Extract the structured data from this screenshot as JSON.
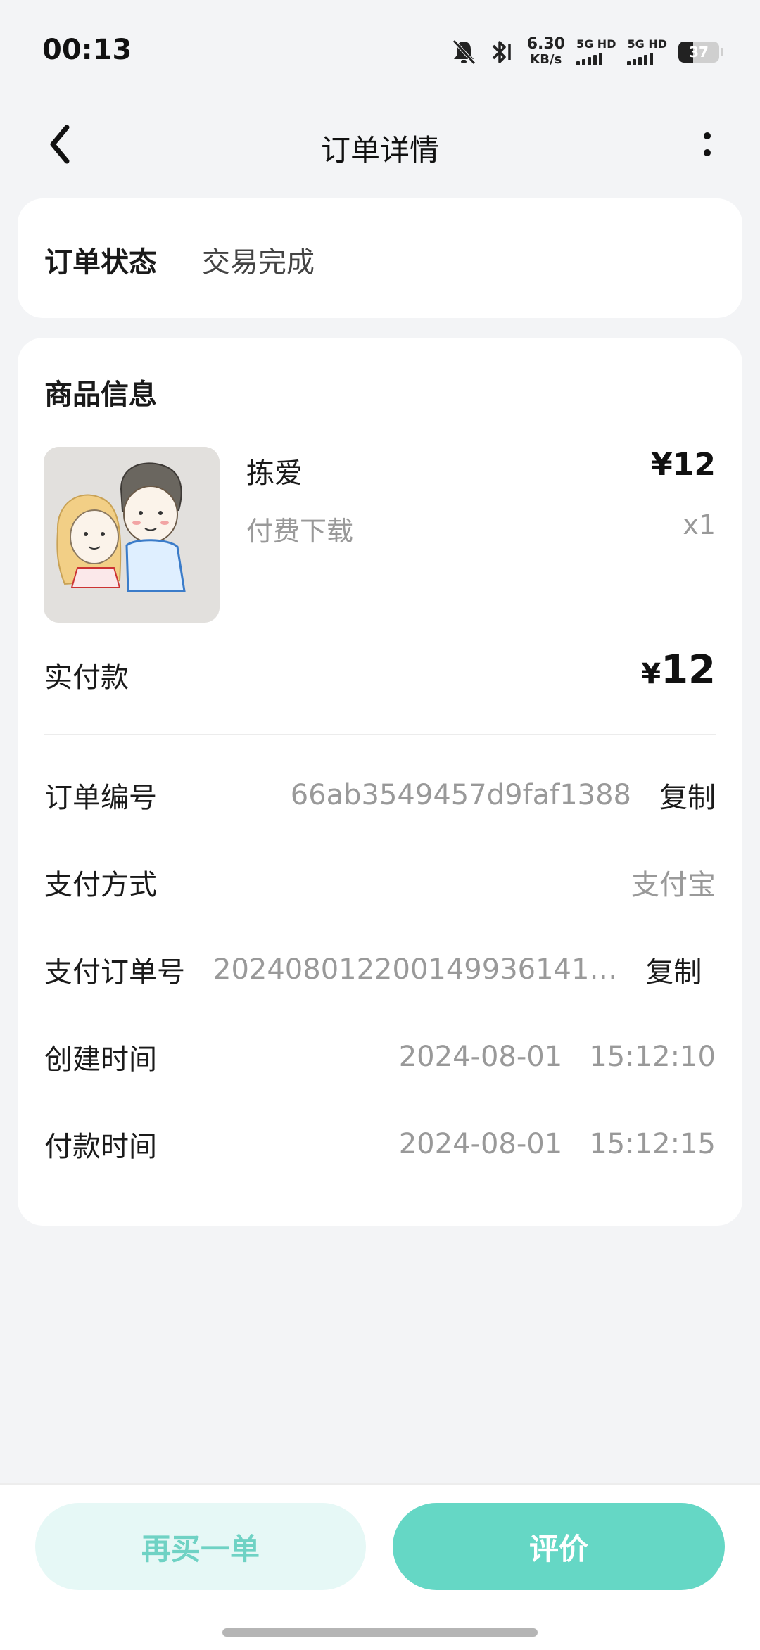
{
  "status_bar": {
    "time": "00:13",
    "net_speed_value": "6.30",
    "net_speed_unit": "KB/s",
    "sim1_label": "5G HD",
    "sim2_label": "5G HD",
    "battery": "37",
    "icons": [
      "mute-bell-icon",
      "bluetooth-icon"
    ]
  },
  "header": {
    "title": "订单详情",
    "back_icon": "chevron-left-icon",
    "more_icon": "vertical-dots-icon"
  },
  "order_status": {
    "label": "订单状态",
    "value": "交易完成"
  },
  "product_section": {
    "title": "商品信息",
    "product": {
      "name": "拣爱",
      "price": "¥12",
      "type": "付费下载",
      "quantity": "x1"
    },
    "paid": {
      "label": "实付款",
      "currency": "¥",
      "amount": "12"
    }
  },
  "details": {
    "order_no": {
      "label": "订单编号",
      "value": "66ab3549457d9faf1388",
      "copy": "复制"
    },
    "pay_method": {
      "label": "支付方式",
      "value": "支付宝"
    },
    "pay_order_no": {
      "label": "支付订单号",
      "value": "202408012200149936141…",
      "copy": "复制"
    },
    "created": {
      "label": "创建时间",
      "value": "2024-08-01   15:12:10"
    },
    "paid_time": {
      "label": "付款时间",
      "value": "2024-08-01   15:12:15"
    }
  },
  "actions": {
    "rebuy": "再买一单",
    "review": "评价"
  },
  "colors": {
    "accent": "#65d7c5",
    "accent_light": "#e6f8f6",
    "background": "#f3f4f6"
  }
}
